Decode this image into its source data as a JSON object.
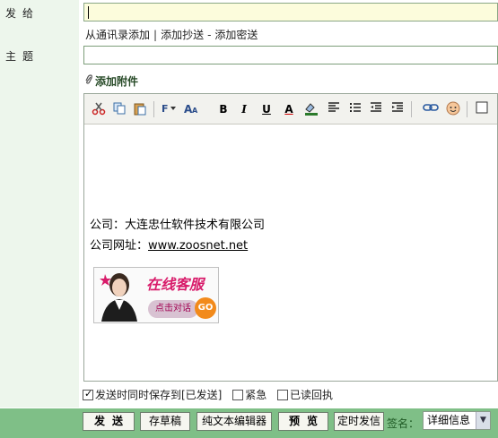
{
  "labels": {
    "to": "发给",
    "subject": "主题"
  },
  "to_field": {
    "value": ""
  },
  "subject_field": {
    "value": ""
  },
  "recipient_links": {
    "address_book": "从通讯录添加",
    "sep1": "|",
    "add_cc": "添加抄送",
    "sep2": "-",
    "add_bcc": "添加密送"
  },
  "attachment": {
    "label": "添加附件"
  },
  "toolbar": {
    "bold": "B",
    "italic": "I",
    "underline": "U",
    "font_color": "A"
  },
  "body": {
    "company_line": "公司：大连忠仕软件技术有限公司",
    "website_prefix": "公司网址：",
    "website_link": "www.zoosnet.net",
    "banner_title": "在线客服",
    "banner_sub": "点击对话",
    "banner_go": "GO"
  },
  "options": {
    "save_sent": {
      "label": "发送时同时保存到[已发送]",
      "checked": true
    },
    "urgent": {
      "label": "紧急",
      "checked": false
    },
    "read_receipt": {
      "label": "已读回执",
      "checked": false
    }
  },
  "actions": {
    "send": "发送",
    "draft": "存草稿",
    "plain_text": "纯文本编辑器",
    "preview": "预览",
    "schedule": "定时发信"
  },
  "signature": {
    "label": "签名：",
    "selected": "详细信息"
  }
}
